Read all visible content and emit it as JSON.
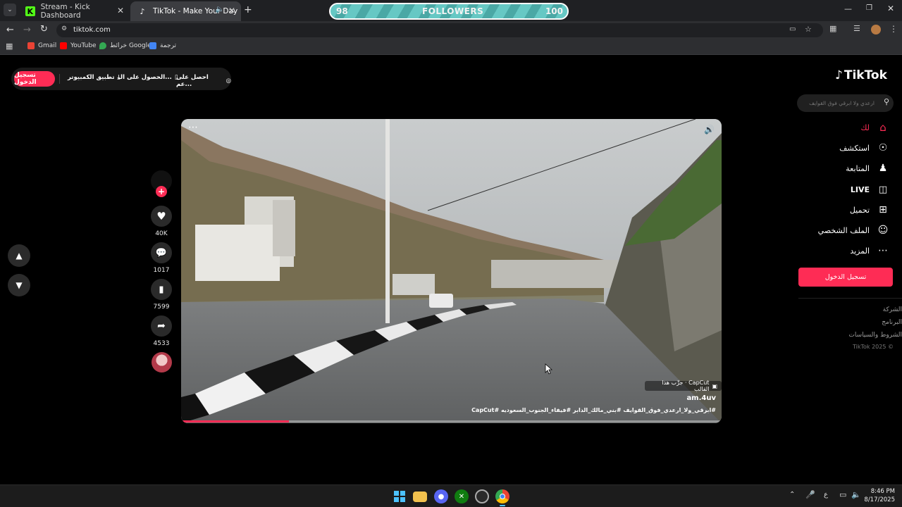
{
  "tabs": [
    {
      "title": "Stream - Kick Dashboard",
      "active": false
    },
    {
      "title": "TikTok - Make Your Day",
      "active": true
    }
  ],
  "address_bar": {
    "url": "tiktok.com"
  },
  "bookmarks": [
    {
      "label": "Gmail"
    },
    {
      "label": "YouTube"
    },
    {
      "label": "خرائط Google"
    },
    {
      "label": "ترجمة"
    }
  ],
  "followers_bar": {
    "left_value": "98",
    "label": "FOLLOWERS",
    "right_value": "100",
    "progress": 0.98
  },
  "header": {
    "login_button": "تسجيل الدخول",
    "desktop_app": "تطبيق الكمبيوتر",
    "get_app": "الحصول على الـ...",
    "get_coins": "احصل على عم..."
  },
  "sidebar": {
    "logo": "TikTok",
    "search_placeholder": "ارعدي ولا ابرقي فوق القوايف",
    "items": [
      {
        "label": "لك",
        "icon": "home-icon",
        "active": true
      },
      {
        "label": "استكشف",
        "icon": "compass-icon",
        "active": false
      },
      {
        "label": "المتابعة",
        "icon": "following-icon",
        "active": false
      },
      {
        "label": "LIVE",
        "icon": "live-icon",
        "active": false
      },
      {
        "label": "تحميل",
        "icon": "upload-icon",
        "active": false
      },
      {
        "label": "الملف الشخصي",
        "icon": "profile-icon",
        "active": false
      },
      {
        "label": "المزيد",
        "icon": "more-icon",
        "active": false
      }
    ],
    "login_button": "تسجيل الدخول",
    "footer": [
      "الشركة",
      "البرنامج",
      "الشروط والسياسات",
      "© 2025 TikTok"
    ]
  },
  "video": {
    "capcut_badge": "CapCut · جرِّب هذا القالب",
    "author": "am.4uv",
    "hashtags": "#ابرقي_ولا_ارعدي_فوق_القوايف #بني_مالك_الدابر #فيفاء_الجنوب_السعوديه #CapCut",
    "progress": 0.2
  },
  "actions": {
    "likes": "40K",
    "comments": "1017",
    "saves": "7599",
    "shares": "4533"
  },
  "taskbar": {
    "time": "8:46 PM",
    "date": "8/17/2025",
    "lang": "ع"
  },
  "colors": {
    "tiktok_red": "#fe2c55",
    "followers_teal": "#5ec0bc"
  }
}
